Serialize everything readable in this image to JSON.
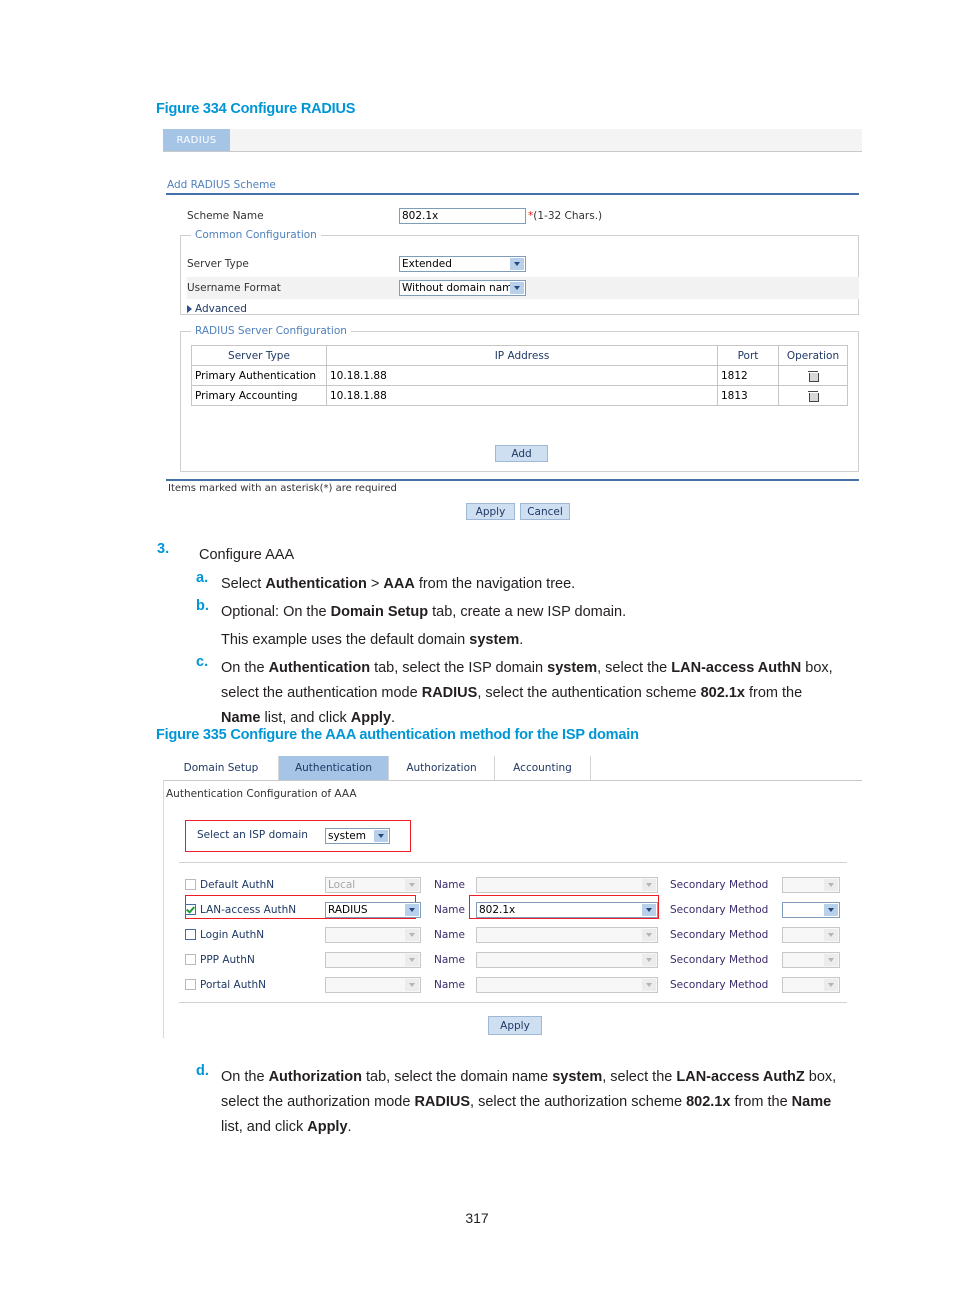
{
  "page": {
    "number": "317"
  },
  "figure334": {
    "caption": "Figure 334 Configure RADIUS",
    "tab_label": "RADIUS",
    "section_title": "Add RADIUS Scheme",
    "scheme_name": {
      "label": "Scheme Name",
      "value": "802.1x",
      "required_mark": "*",
      "hint": "(1-32 Chars.)"
    },
    "common_configuration": {
      "legend": "Common Configuration",
      "server_type": {
        "label": "Server Type",
        "value": "Extended"
      },
      "username_format": {
        "label": "Username Format",
        "value": "Without domain name"
      },
      "advanced_label": "Advanced"
    },
    "server_configuration": {
      "legend": "RADIUS Server Configuration",
      "columns": [
        "Server Type",
        "IP Address",
        "Port",
        "Operation"
      ],
      "rows": [
        {
          "server_type": "Primary Authentication",
          "ip_address": "10.18.1.88",
          "port": "1812",
          "operation_icon": "trash-icon"
        },
        {
          "server_type": "Primary Accounting",
          "ip_address": "10.18.1.88",
          "port": "1813",
          "operation_icon": "trash-icon"
        }
      ],
      "add_button": "Add"
    },
    "footnote": "Items marked with an asterisk(*) are required",
    "apply_button": "Apply",
    "cancel_button": "Cancel"
  },
  "steps": {
    "step3": {
      "marker": "3.",
      "text": "Configure AAA"
    },
    "a": {
      "marker": "a.",
      "line1_pre": "Select ",
      "line1_b1": "Authentication",
      "line1_mid": " > ",
      "line1_b2": "AAA",
      "line1_post": " from the navigation tree."
    },
    "b": {
      "marker": "b.",
      "line1_pre": "Optional: On the ",
      "line1_b1": "Domain Setup",
      "line1_post": " tab, create a new ISP domain.",
      "line2_pre": "This example uses the default domain ",
      "line2_b1": "system",
      "line2_post": "."
    },
    "c": {
      "marker": "c.",
      "l1_p1": "On the ",
      "l1_b1": "Authentication",
      "l1_p2": " tab, select the ISP domain ",
      "l1_b2": "system",
      "l1_p3": ", select the ",
      "l1_b3": "LAN-access AuthN",
      "l1_p4": " box,",
      "l2_p1": "select the authentication mode ",
      "l2_b1": "RADIUS",
      "l2_p2": ", select the authentication scheme ",
      "l2_b2": "802.1x",
      "l2_p3": " from the",
      "l3_b1": "Name",
      "l3_p1": " list, and click ",
      "l3_b2": "Apply",
      "l3_p2": "."
    },
    "d": {
      "marker": "d.",
      "l1_p1": "On the ",
      "l1_b1": "Authorization",
      "l1_p2": " tab, select the domain name ",
      "l1_b2": "system",
      "l1_p3": ", select the ",
      "l1_b3": "LAN-access AuthZ",
      "l1_p4": " box,",
      "l2_p1": "select the authorization mode ",
      "l2_b1": "RADIUS",
      "l2_p2": ", select the authorization scheme ",
      "l2_b2": "802.1x",
      "l2_p3": " from the ",
      "l2_b3": "Name",
      "l3_p1": "list, and click ",
      "l3_b1": "Apply",
      "l3_p2": "."
    }
  },
  "figure335": {
    "caption": "Figure 335 Configure the AAA authentication method for the ISP domain",
    "tabs": [
      {
        "label": "Domain Setup",
        "active": false
      },
      {
        "label": "Authentication",
        "active": true
      },
      {
        "label": "Authorization",
        "active": false
      },
      {
        "label": "Accounting",
        "active": false
      }
    ],
    "panel_title": "Authentication Configuration of AAA",
    "isp_domain": {
      "label": "Select an ISP domain",
      "value": "system"
    },
    "name_label": "Name",
    "secondary_method_label": "Secondary Method",
    "rows": [
      {
        "label": "Default AuthN",
        "checked": false,
        "enabled": false,
        "mode": "Local",
        "name_value": "",
        "secondary_value": ""
      },
      {
        "label": "LAN-access AuthN",
        "checked": true,
        "enabled": true,
        "mode": "RADIUS",
        "name_value": "802.1x",
        "secondary_value": ""
      },
      {
        "label": "Login AuthN",
        "checked": false,
        "enabled": false,
        "mode": "",
        "name_value": "",
        "secondary_value": ""
      },
      {
        "label": "PPP AuthN",
        "checked": false,
        "enabled": false,
        "mode": "",
        "name_value": "",
        "secondary_value": ""
      },
      {
        "label": "Portal AuthN",
        "checked": false,
        "enabled": false,
        "mode": "",
        "name_value": "",
        "secondary_value": ""
      }
    ],
    "apply_button": "Apply"
  },
  "colors": {
    "caption_blue": "#0096d6",
    "tab_active": "#a6c5e6",
    "highlight_red": "#ee1c25",
    "button_blue": "#cfdff2",
    "rule_blue": "#4472a8"
  }
}
